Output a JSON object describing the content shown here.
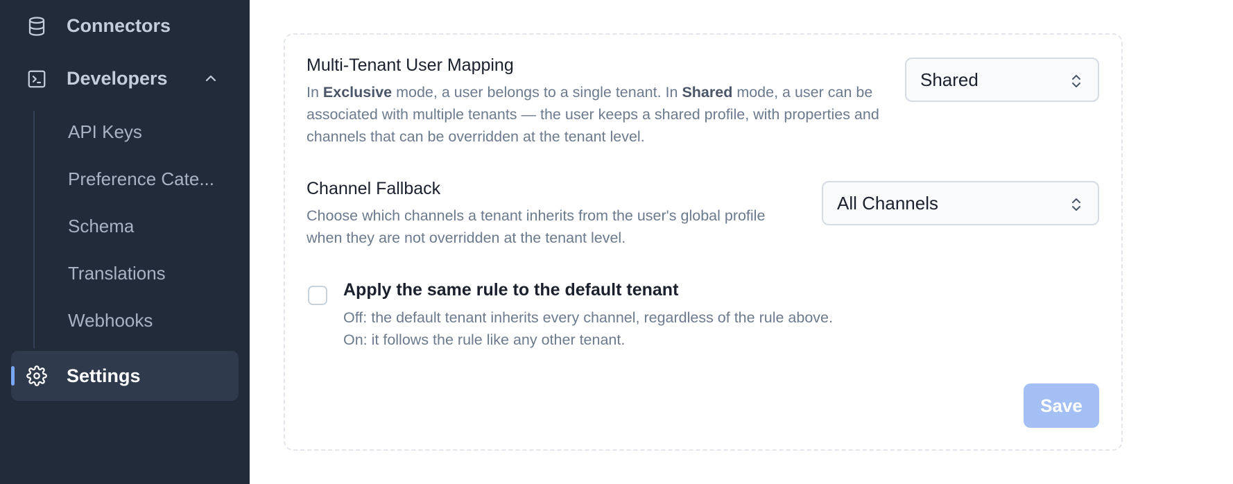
{
  "sidebar": {
    "connectors": {
      "label": "Connectors",
      "icon": "database-icon"
    },
    "developers": {
      "label": "Developers",
      "icon": "terminal-icon",
      "expanded": true
    },
    "sub_items": [
      {
        "label": "API Keys"
      },
      {
        "label": "Preference Cate..."
      },
      {
        "label": "Schema"
      },
      {
        "label": "Translations"
      },
      {
        "label": "Webhooks"
      }
    ],
    "settings": {
      "label": "Settings",
      "icon": "gear-icon",
      "active": true
    }
  },
  "main": {
    "mapping": {
      "title": "Multi-Tenant User Mapping",
      "desc_1": "In ",
      "desc_bold_1": "Exclusive",
      "desc_2": " mode, a user belongs to a single tenant. In ",
      "desc_bold_2": "Shared",
      "desc_3": " mode, a user can be associated with multiple tenants — the user keeps a shared profile, with properties and channels that can be overridden at the tenant level.",
      "select_value": "Shared"
    },
    "fallback": {
      "title": "Channel Fallback",
      "desc": "Choose which channels a tenant inherits from the user's global profile when they are not overridden at the tenant level.",
      "select_value": "All Channels"
    },
    "default_rule": {
      "label": "Apply the same rule to the default tenant",
      "desc_off": "Off: the default tenant inherits every channel, regardless of the rule above.",
      "desc_on": "On: it follows the rule like any other tenant.",
      "checked": false
    },
    "save_label": "Save"
  },
  "colors": {
    "sidebar_bg": "#222b3a",
    "active_item_bg": "#2f3a4c",
    "accent": "#7aa7f5",
    "save_button_disabled": "#a4bff3"
  }
}
